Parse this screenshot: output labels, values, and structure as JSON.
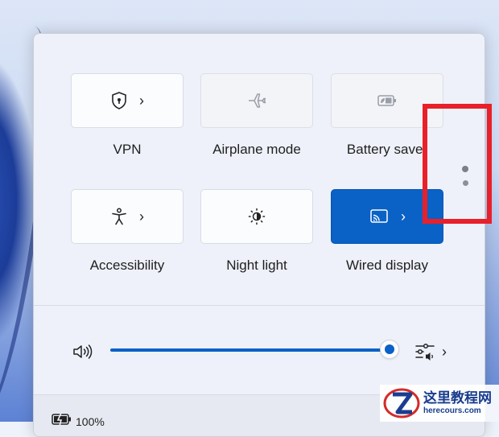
{
  "tiles": [
    {
      "label": "VPN",
      "icon": "shield-lock-icon",
      "state": "off",
      "has_chevron": true
    },
    {
      "label": "Airplane mode",
      "icon": "airplane-icon",
      "state": "disabled",
      "has_chevron": false
    },
    {
      "label": "Battery saver",
      "icon": "battery-saver-icon",
      "state": "disabled",
      "has_chevron": false
    },
    {
      "label": "Accessibility",
      "icon": "accessibility-person-icon",
      "state": "off",
      "has_chevron": true
    },
    {
      "label": "Night light",
      "icon": "night-light-icon",
      "state": "off",
      "has_chevron": true
    },
    {
      "label": "Wired display",
      "icon": "cast-display-icon",
      "state": "on",
      "has_chevron": true
    }
  ],
  "chevron": "›",
  "page_indicator": {
    "pages": 2,
    "current": 1
  },
  "volume": {
    "level_percent": 100,
    "icon": "speaker-icon",
    "mixer_icon": "audio-mixer-icon"
  },
  "battery": {
    "text": "100%",
    "icon": "battery-charging-icon"
  },
  "watermark": {
    "title": "这里教程网",
    "url": "herecours.com"
  },
  "colors": {
    "accent": "#0a61c6",
    "annotation": "#e8202a"
  }
}
